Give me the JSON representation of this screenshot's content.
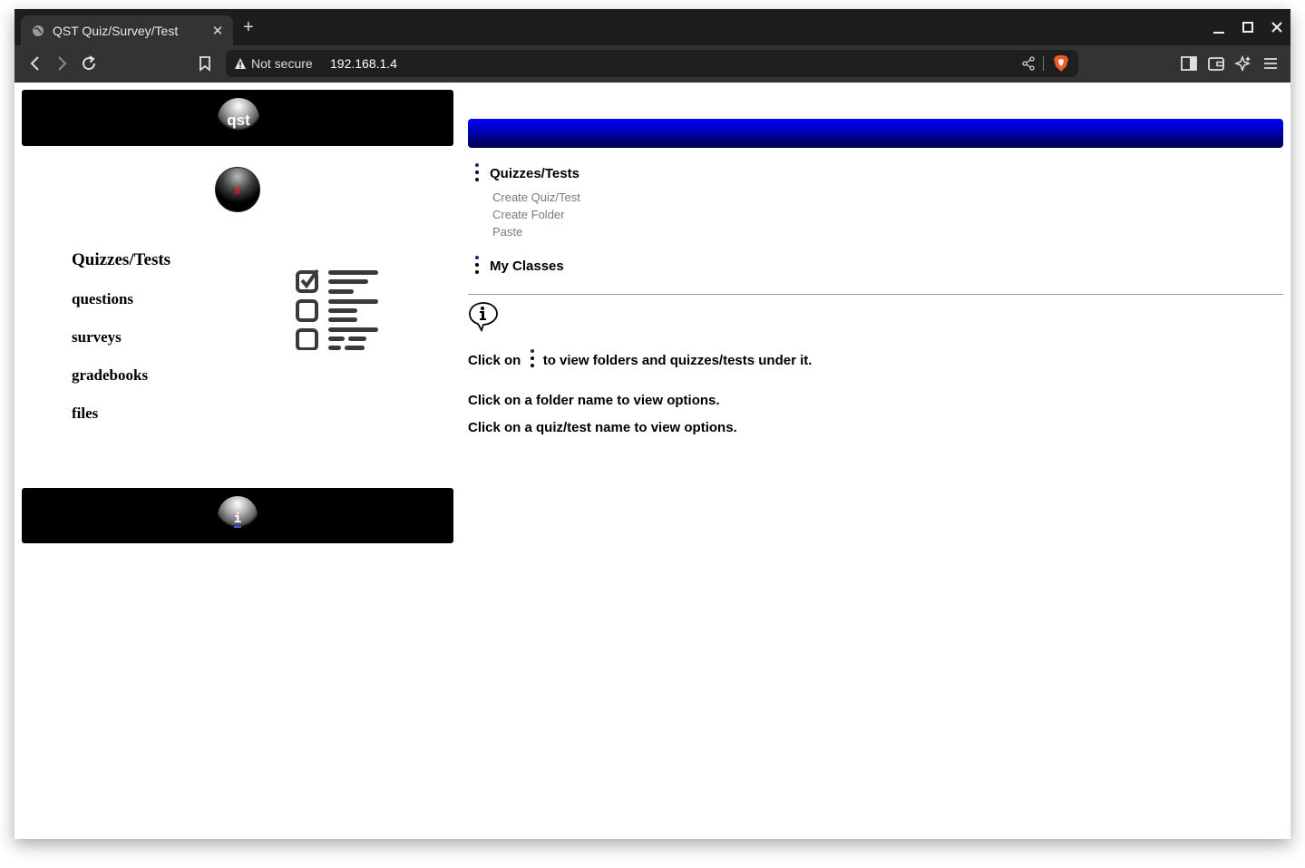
{
  "browser": {
    "tab_title": "QST Quiz/Survey/Test",
    "tab_close": "✕",
    "new_tab": "+",
    "security_label": "Not secure",
    "url": "192.168.1.4",
    "window_controls": {
      "minimize": "—",
      "maximize": "▢",
      "close": "✕"
    }
  },
  "left": {
    "logo_button": "qst",
    "close_button": "x",
    "nav": [
      {
        "label": "Quizzes/Tests"
      },
      {
        "label": "questions"
      },
      {
        "label": "surveys"
      },
      {
        "label": "gradebooks"
      },
      {
        "label": "files"
      }
    ],
    "info_button": "i"
  },
  "right": {
    "sections": [
      {
        "title": "Quizzes/Tests",
        "items": [
          "Create Quiz/Test",
          "Create Folder",
          "Paste"
        ]
      },
      {
        "title": "My Classes"
      }
    ],
    "help": {
      "line1_before": "Click on",
      "line1_after": "to view folders and quizzes/tests under it.",
      "line2": "Click on a folder name to view options.",
      "line3": "Click on a quiz/test name to view options."
    }
  },
  "colors": {
    "accent_blue": "#0000ff",
    "panel_black": "#000000",
    "close_red": "#ff1010",
    "menu_link_gray": "#7a7a7a"
  },
  "icons": [
    "globe-icon",
    "back-icon",
    "forward-icon",
    "reload-icon",
    "bookmark-icon",
    "warning-icon",
    "share-icon",
    "brave-shield-icon",
    "sidebar-icon",
    "wallet-icon",
    "leo-ai-icon",
    "menu-icon",
    "checklist-icon",
    "kebab-icon",
    "info-bubble-icon"
  ]
}
